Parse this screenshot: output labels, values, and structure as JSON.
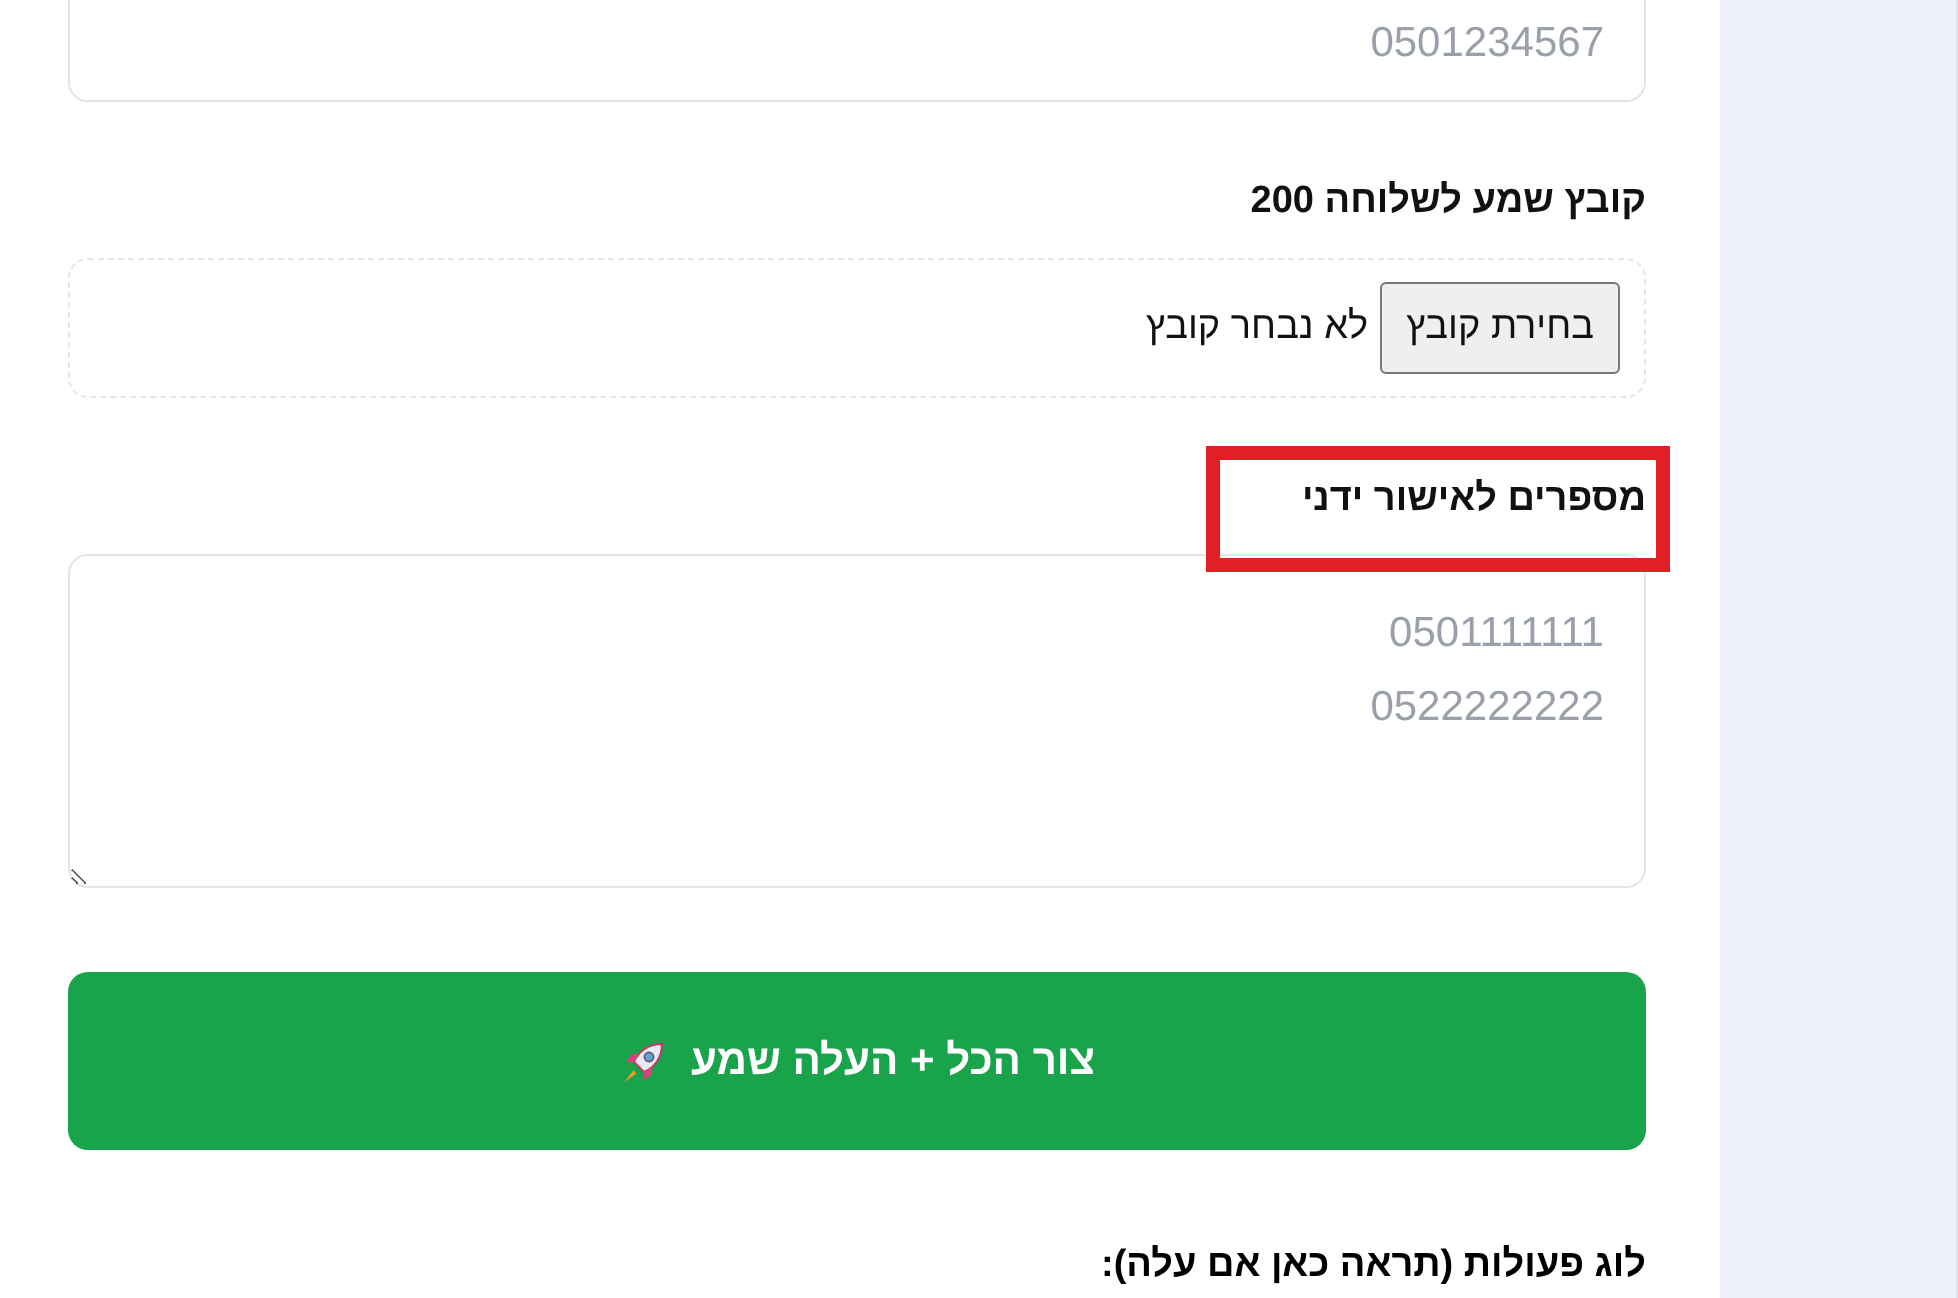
{
  "phone_field": {
    "placeholder": "0501234567"
  },
  "audio_file": {
    "label": "קובץ שמע לשלוחה 200",
    "button": "בחירת קובץ",
    "status": "לא נבחר קובץ"
  },
  "manual_numbers": {
    "label": "מספרים לאישור ידני",
    "highlighted": true,
    "placeholder": "0501111111\n0522222222"
  },
  "submit_button": {
    "label": "צור הכל + העלה שמע"
  },
  "log": {
    "title": "לוג פעולות (תראה כאן אם עלה):"
  }
}
